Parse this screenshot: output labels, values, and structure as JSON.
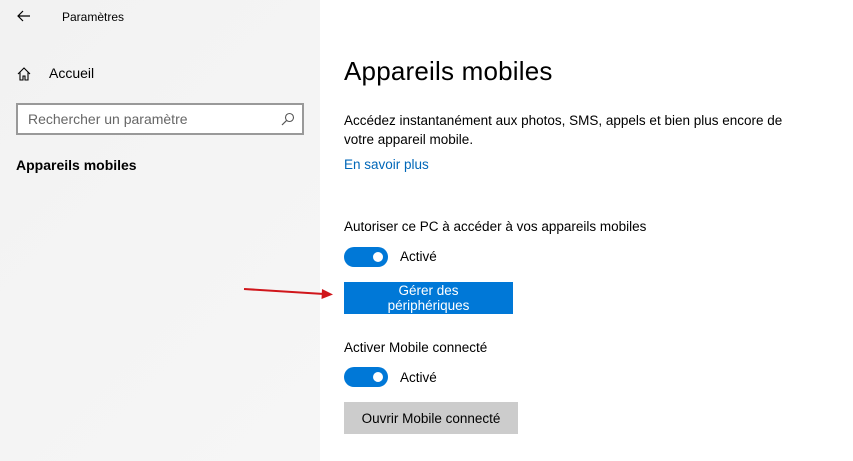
{
  "window": {
    "title": "Paramètres"
  },
  "sidebar": {
    "home_label": "Accueil",
    "search_placeholder": "Rechercher un paramètre",
    "current_item": "Appareils mobiles"
  },
  "main": {
    "title": "Appareils mobiles",
    "description": "Accédez instantanément aux photos, SMS, appels et bien plus encore de votre appareil mobile.",
    "learn_more": "En savoir plus",
    "setting1": {
      "label": "Autoriser ce PC à accéder à vos appareils mobiles",
      "toggle_state": "Activé",
      "toggle_on": true,
      "button_label": "Gérer des périphériques"
    },
    "setting2": {
      "label": "Activer Mobile connecté",
      "toggle_state": "Activé",
      "toggle_on": true,
      "button_label": "Ouvrir Mobile connecté"
    }
  },
  "icons": {
    "back": "arrow-left-icon",
    "home": "home-icon",
    "search": "search-icon"
  },
  "colors": {
    "accent": "#0078d7",
    "link": "#0067b8",
    "secondary_button": "#cccccc",
    "annotation_arrow": "#d0161b"
  }
}
